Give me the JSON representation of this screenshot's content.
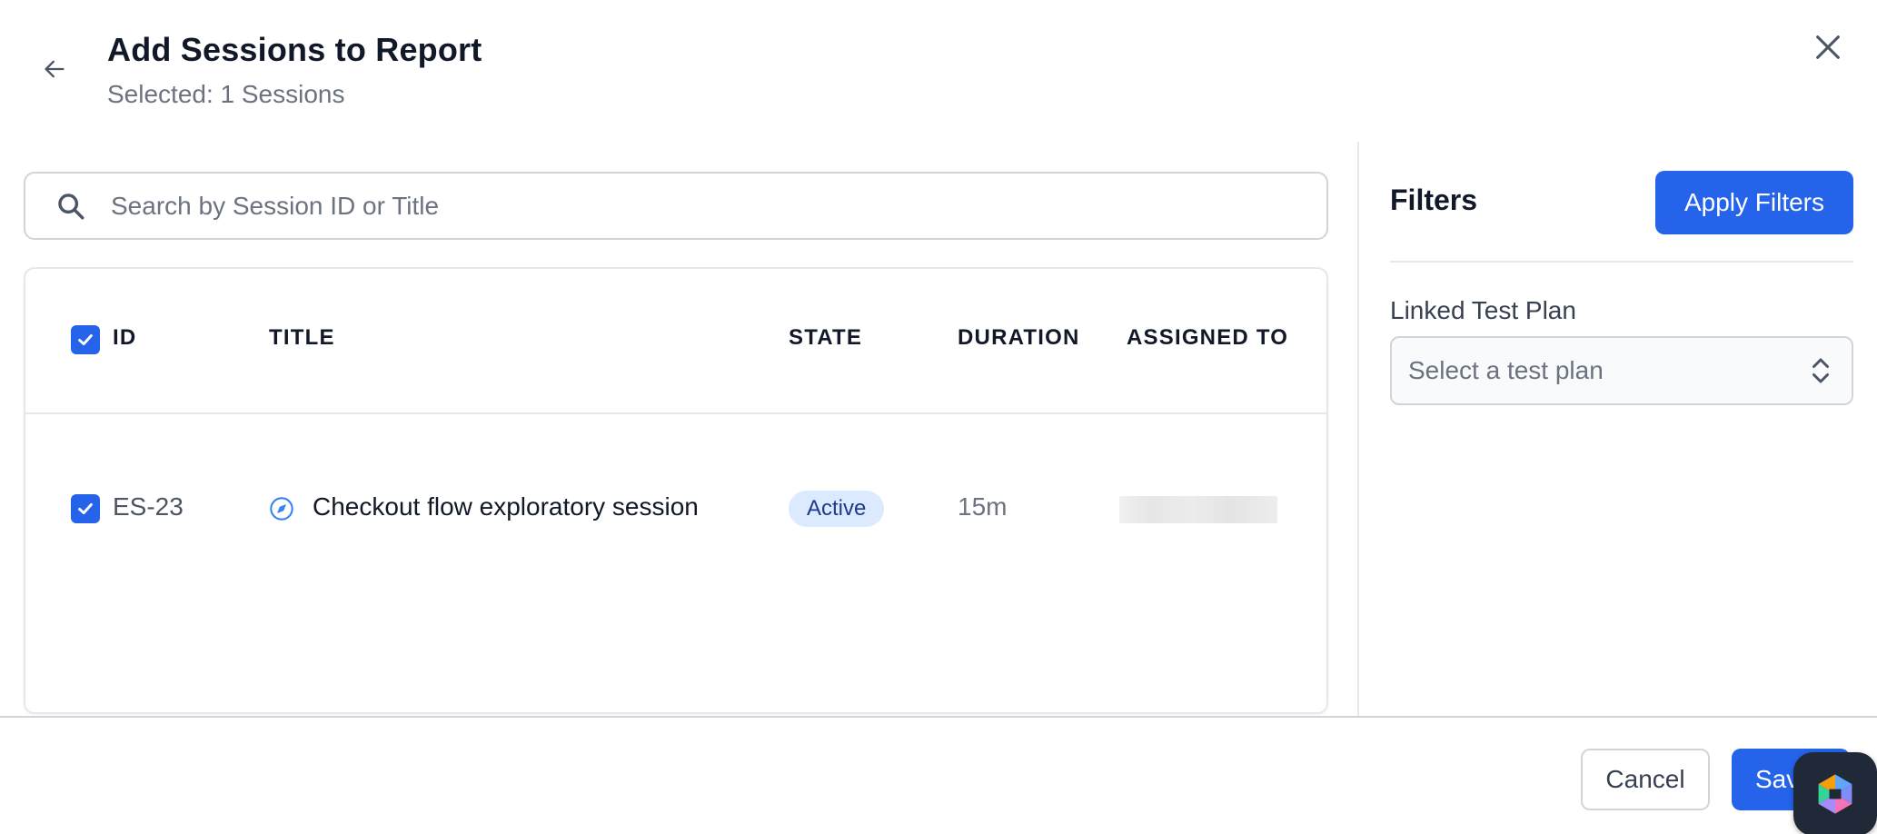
{
  "header": {
    "title": "Add Sessions to Report",
    "subtitle": "Selected: 1 Sessions"
  },
  "search": {
    "placeholder": "Search by Session ID or Title",
    "value": ""
  },
  "table": {
    "columns": [
      "ID",
      "TITLE",
      "STATE",
      "DURATION",
      "ASSIGNED TO"
    ],
    "select_all_checked": true,
    "rows": [
      {
        "checked": true,
        "id": "ES-23",
        "title": "Checkout flow exploratory session",
        "title_icon": "compass-icon",
        "state": "Active",
        "duration": "15m",
        "assigned_to": ""
      }
    ]
  },
  "filters": {
    "title": "Filters",
    "apply_label": "Apply Filters",
    "linked_test_plan": {
      "label": "Linked Test Plan",
      "placeholder": "Select a test plan"
    }
  },
  "footer": {
    "cancel_label": "Cancel",
    "save_label": "Save"
  },
  "colors": {
    "primary": "#2563eb",
    "badge_bg": "#dbeafe",
    "badge_text": "#1e3a8a",
    "border": "#e5e7eb"
  }
}
